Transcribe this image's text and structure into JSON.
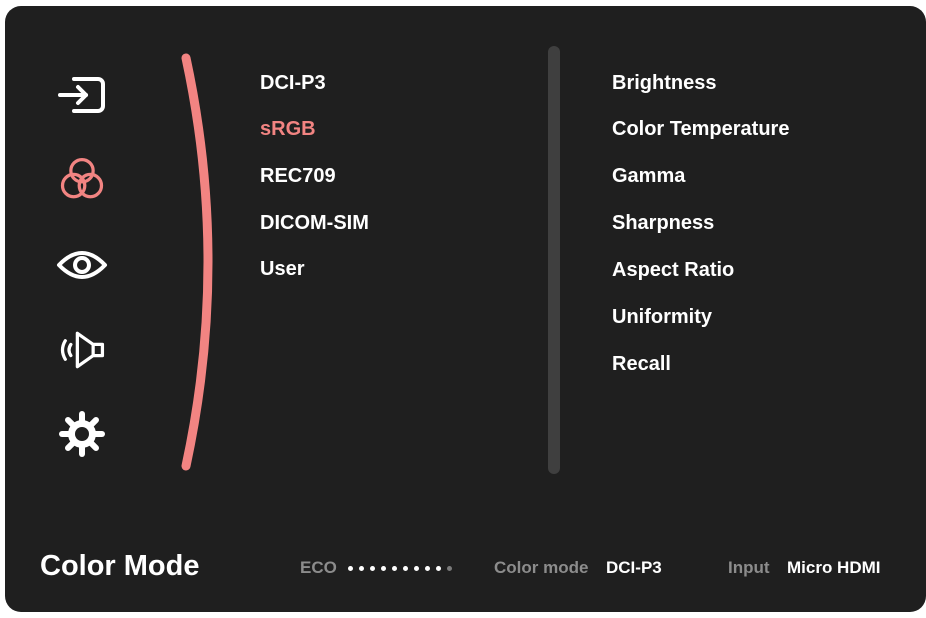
{
  "sidebar": {
    "icons": [
      "input-icon",
      "color-icon",
      "eye-icon",
      "audio-icon",
      "settings-icon"
    ],
    "selected_icon": "color-icon",
    "accent_color": "#f28482"
  },
  "menu": {
    "items": [
      "DCI-P3",
      "sRGB",
      "REC709",
      "DICOM-SIM",
      "User"
    ],
    "selected": "sRGB"
  },
  "submenu": {
    "items": [
      "Brightness",
      "Color Temperature",
      "Gamma",
      "Sharpness",
      "Aspect Ratio",
      "Uniformity",
      "Recall"
    ]
  },
  "footer": {
    "title": "Color Mode",
    "eco_label": "ECO",
    "eco_level_fraction": 0.9,
    "color_mode_label": "Color mode",
    "color_mode_value": "DCI-P3",
    "input_label": "Input",
    "input_value": "Micro HDMI"
  }
}
